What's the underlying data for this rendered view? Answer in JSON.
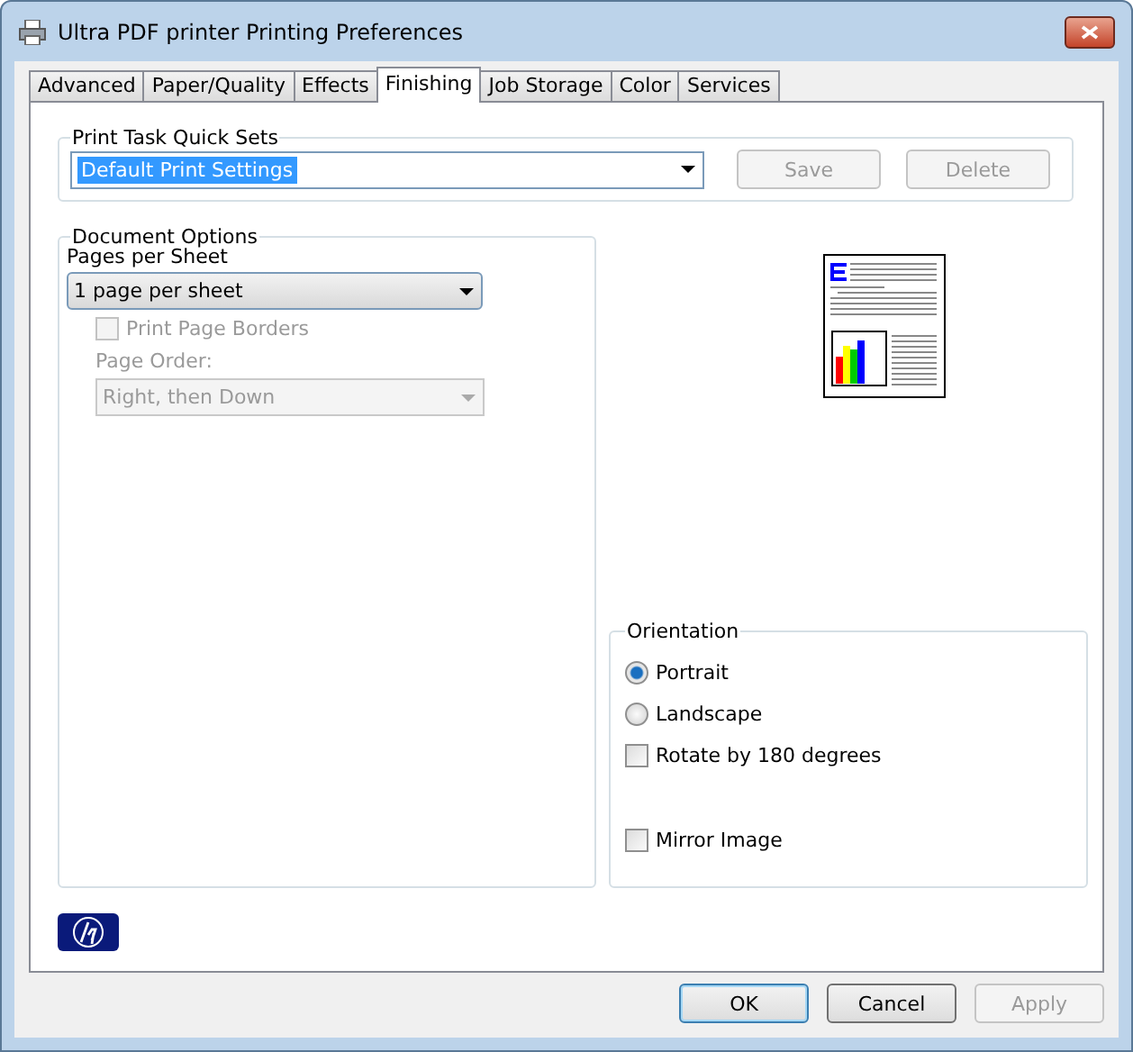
{
  "window": {
    "title": "Ultra PDF printer Printing Preferences"
  },
  "tabs": [
    {
      "label": "Advanced",
      "selected": false
    },
    {
      "label": "Paper/Quality",
      "selected": false
    },
    {
      "label": "Effects",
      "selected": false
    },
    {
      "label": "Finishing",
      "selected": true
    },
    {
      "label": "Job Storage",
      "selected": false
    },
    {
      "label": "Color",
      "selected": false
    },
    {
      "label": "Services",
      "selected": false
    }
  ],
  "quick_sets": {
    "label": "Print Task Quick Sets",
    "value": "Default Print Settings",
    "buttons": [
      {
        "label": "Save",
        "disabled": true
      },
      {
        "label": "Delete",
        "disabled": true
      }
    ]
  },
  "document_options": {
    "label": "Document Options",
    "pages_label": "Pages per Sheet",
    "pages_value": "1 page per sheet",
    "borders": {
      "label": "Print Page Borders",
      "checked": false,
      "disabled": true
    },
    "order_label": "Page Order:",
    "order_value": "Right, then Down",
    "order_disabled": true
  },
  "orientation": {
    "label": "Orientation",
    "items": [
      {
        "kind": "radio",
        "label": "Portrait",
        "selected": true
      },
      {
        "kind": "radio",
        "label": "Landscape",
        "selected": false
      },
      {
        "kind": "checkbox",
        "label": "Rotate by 180 degrees",
        "checked": false
      },
      {
        "kind": "spacer"
      },
      {
        "kind": "checkbox",
        "label": "Mirror Image",
        "checked": false
      }
    ]
  },
  "buttons": [
    {
      "label": "OK",
      "disabled": false,
      "default": true
    },
    {
      "label": "Cancel",
      "disabled": false,
      "default": false
    },
    {
      "label": "Apply",
      "disabled": true,
      "default": false
    }
  ]
}
